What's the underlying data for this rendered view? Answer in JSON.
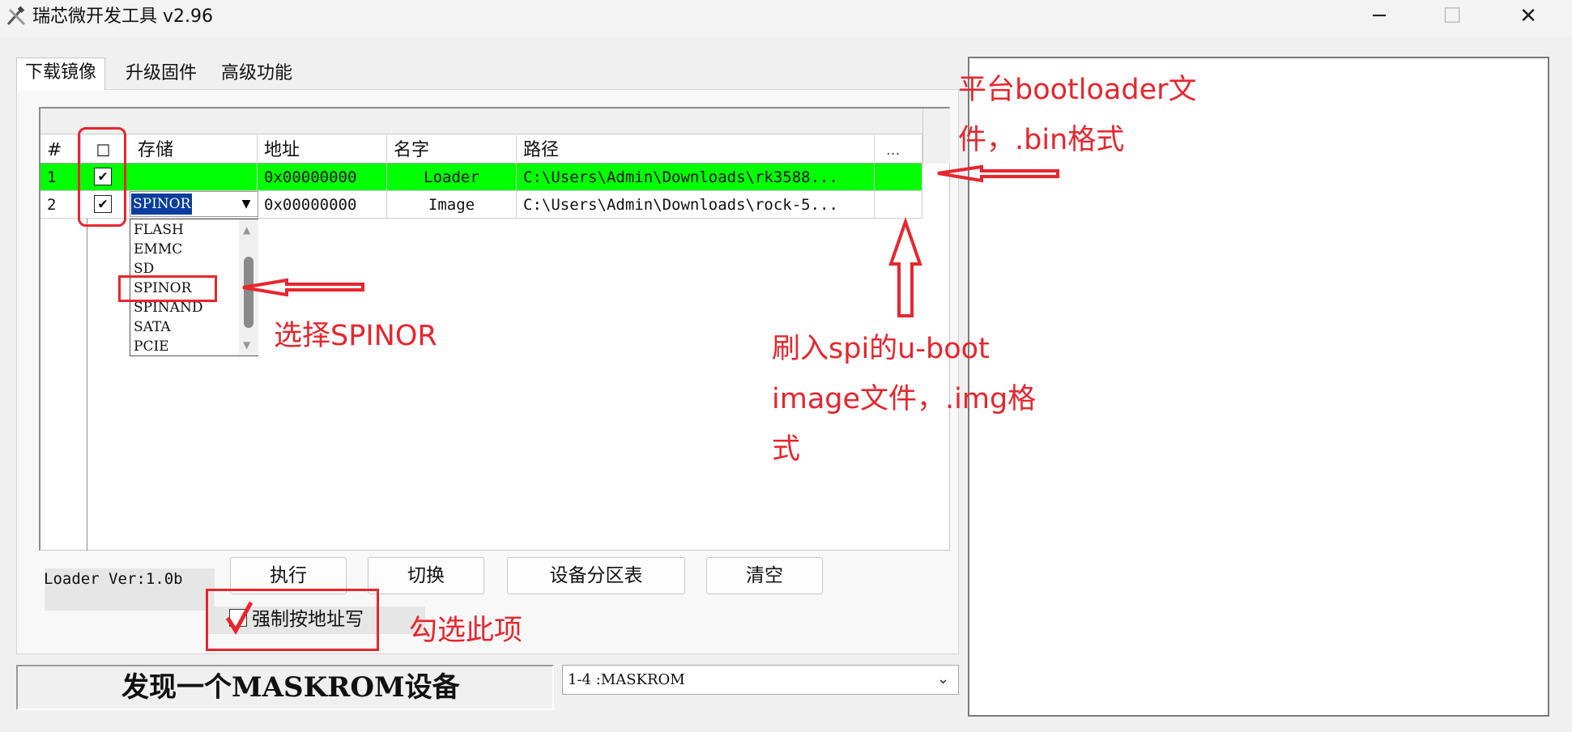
{
  "window": {
    "title": "瑞芯微开发工具 v2.96",
    "icon": "tools-icon",
    "buttons": {
      "minimize": "─",
      "maximize": "☐",
      "close": "✕"
    }
  },
  "tabs": [
    {
      "label": "下载镜像",
      "active": true
    },
    {
      "label": "升级固件",
      "active": false
    },
    {
      "label": "高级功能",
      "active": false
    }
  ],
  "grid": {
    "headers": {
      "index": "#",
      "check": "☐",
      "storage": "存储",
      "address": "地址",
      "name": "名字",
      "path": "路径",
      "more": "..."
    },
    "rows": [
      {
        "index": "1",
        "checked": "✔",
        "storage": "",
        "address": "0x00000000",
        "name": "Loader",
        "path": "C:\\Users\\Admin\\Downloads\\rk3588...",
        "highlight_color": "#00ff00"
      },
      {
        "index": "2",
        "checked": "✔",
        "storage": "SPINOR",
        "address": "0x00000000",
        "name": "Image",
        "path": "C:\\Users\\Admin\\Downloads\\rock-5..."
      }
    ],
    "storage_options": [
      "FLASH",
      "EMMC",
      "SD",
      "SPINOR",
      "SPINAND",
      "SATA",
      "PCIE"
    ],
    "storage_selected": "SPINOR"
  },
  "loader_version": "Loader Ver:1.0b",
  "buttons": {
    "run": "执行",
    "switch": "切换",
    "partition": "设备分区表",
    "clear": "清空"
  },
  "force_address": {
    "label": "强制按地址写",
    "checked": true
  },
  "status": {
    "message": "发现一个MASKROM设备",
    "device": "1-4 :MASKROM"
  },
  "annotations": {
    "bootloader_line1": "平台bootloader文",
    "bootloader_line2": "件，.bin格式",
    "select_spinor": "选择SPINOR",
    "image_line1": "刷入spi的u-boot",
    "image_line2": "image文件，.img格",
    "image_line3": "式",
    "check_this": "勾选此项",
    "color": "#e8252d"
  }
}
